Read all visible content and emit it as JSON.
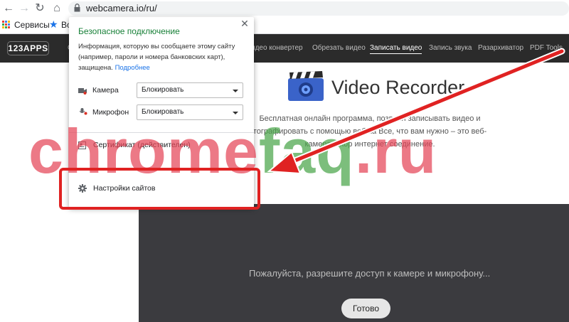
{
  "browser": {
    "url": "webcamera.io/ru/",
    "bookmarks": {
      "apps_label": "Сервисы",
      "item_partial": "Во"
    }
  },
  "site": {
    "logo": "123APPS",
    "nav_partial": "С",
    "nav": [
      "идео конвертер",
      "Обрезать видео",
      "Записать видео",
      "Запись звука",
      "Разархиватор",
      "PDF Tools"
    ],
    "active_nav": "Записать видео",
    "hero_title": "Video Recorder",
    "hero_description": "Бесплатная онлайн программа, позволя... записывать видео и ...тографировать с помощью веб-ка... Все, что вам нужно – это веб-камера и хор... интернет соединение.",
    "hero_line1": "Бесплатная онлайн программа, позволя   записывать видео и",
    "hero_line2": "тографировать с помощью веб-ка    Все, что вам нужно – это веб-",
    "hero_line3": "камера и хор           интернет соединение.",
    "recorder_message": "Пожалуйста, разрешите доступ к камере и микрофону...",
    "done_button": "Готово"
  },
  "popup": {
    "title": "Безопасное подключение",
    "description": "Информация, которую вы сообщаете этому сайту (например, пароли и номера банковских карт), защищена.",
    "link": "Подробнее",
    "permissions": [
      {
        "label": "Камера",
        "value": "Блокировать"
      },
      {
        "label": "Микрофон",
        "value": "Блокировать"
      }
    ],
    "certificate": "Сертификат (действителен)",
    "site_settings": "Настройки сайтов"
  },
  "watermark": {
    "part1": "chrome",
    "part2": "faq",
    "part3": ".ru"
  },
  "colors": {
    "secure_green": "#188038",
    "link_blue": "#1a73e8",
    "highlight_red": "#e02222",
    "site_bar": "#2b2b2b",
    "recorder_bg": "#3b3b3f"
  }
}
